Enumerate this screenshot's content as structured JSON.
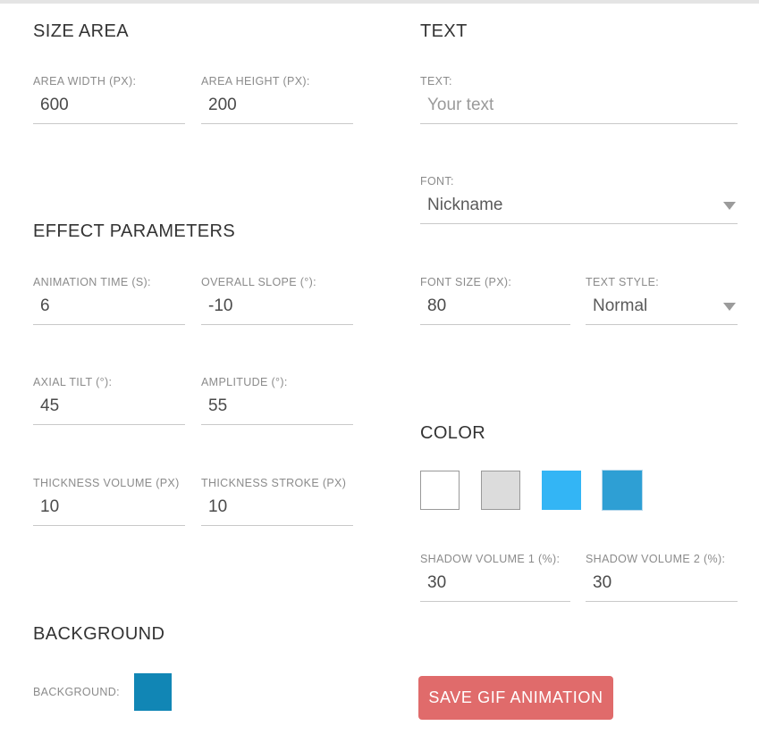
{
  "theme": {
    "accent_blue": "#1186b5",
    "save_button_bg": "#e06b6b",
    "label_gray": "#8b8b8b",
    "heading_gray": "#333333",
    "underline_gray": "#c9c9c9",
    "top_strip": "#e4e4e4"
  },
  "left_column": {
    "size_area": {
      "heading": "SIZE AREA",
      "fields": [
        {
          "label": "AREA WIDTH (PX):",
          "value": "600"
        },
        {
          "label": "AREA HEIGHT (PX):",
          "value": "200"
        }
      ]
    },
    "effect_parameters": {
      "heading": "EFFECT PARAMETERS",
      "fields": [
        {
          "label": "ANIMATION TIME (S):",
          "value": "6"
        },
        {
          "label": "OVERALL SLOPE (°):",
          "value": "-10"
        },
        {
          "label": "AXIAL TILT (°):",
          "value": "45"
        },
        {
          "label": "AMPLITUDE (°):",
          "value": "55"
        },
        {
          "label": "THICKNESS VOLUME (PX)",
          "value": "10"
        },
        {
          "label": "THICKNESS STROKE (PX)",
          "value": "10"
        }
      ]
    },
    "background": {
      "heading": "BACKGROUND",
      "label": "BACKGROUND:",
      "color": "#1186b5"
    }
  },
  "right_column": {
    "text": {
      "heading": "TEXT",
      "text_field": {
        "label": "TEXT:",
        "value": "",
        "placeholder": "Your text"
      },
      "font_field": {
        "label": "FONT:",
        "value": "Nickname",
        "icon": "chevron-down-icon"
      },
      "font_size_field": {
        "label": "FONT SIZE (PX):",
        "value": "80"
      },
      "text_style_field": {
        "label": "TEXT STYLE:",
        "value": "Normal",
        "icon": "chevron-down-icon"
      }
    },
    "color": {
      "heading": "COLOR",
      "swatches": [
        {
          "name": "white",
          "color": "#ffffff",
          "outlined": true,
          "selected": false
        },
        {
          "name": "light-gray",
          "color": "#dcdcdc",
          "outlined": true,
          "selected": false
        },
        {
          "name": "bright-blue",
          "color": "#33b5f5",
          "outlined": false,
          "selected": false
        },
        {
          "name": "medium-blue",
          "color": "#2e9fd4",
          "outlined": false,
          "selected": true
        }
      ],
      "shadow_fields": [
        {
          "label": "SHADOW VOLUME 1 (%):",
          "value": "30"
        },
        {
          "label": "SHADOW VOLUME 2 (%):",
          "value": "30"
        }
      ]
    },
    "save_button": {
      "label": "SAVE GIF ANIMATION"
    }
  }
}
